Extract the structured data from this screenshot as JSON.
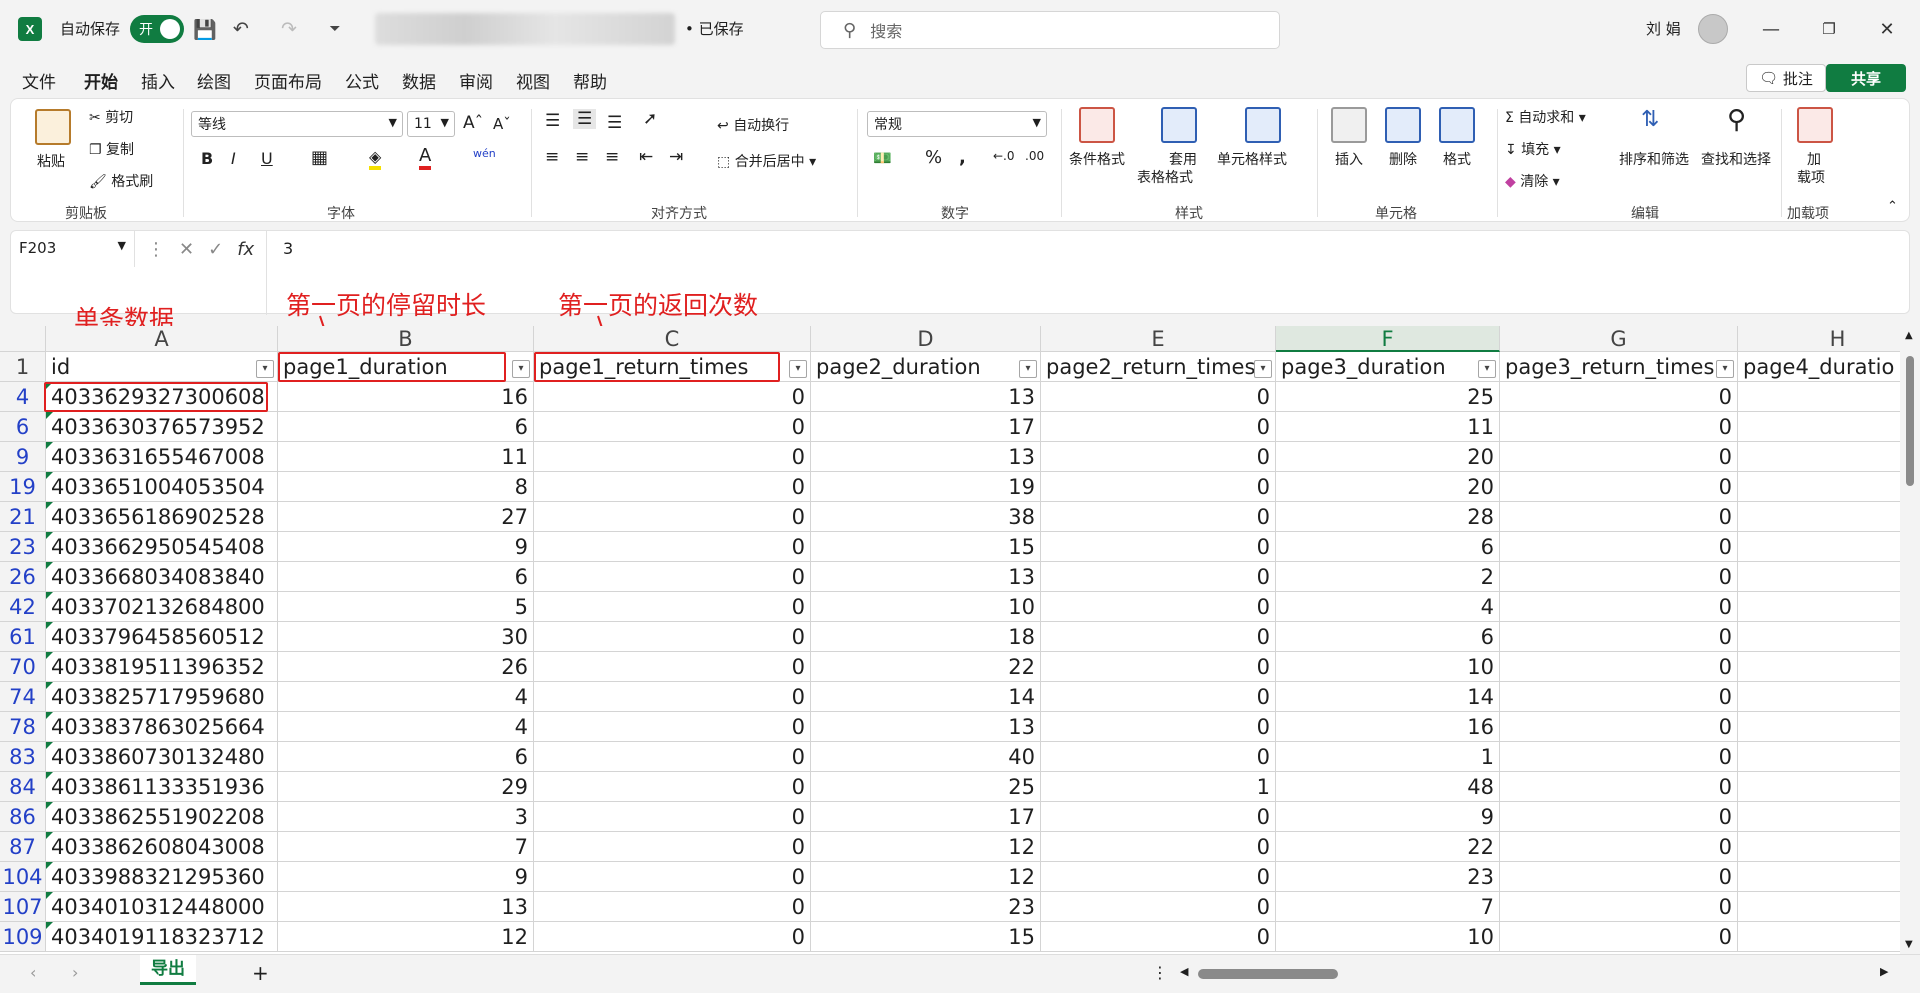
{
  "title_bar": {
    "app_logo": "X",
    "autosave_label": "自动保存",
    "autosave_state": "开",
    "saved_status": "• 已保存",
    "search_placeholder": "搜索",
    "user_name": "刘 娟"
  },
  "menu": {
    "tabs": [
      "文件",
      "开始",
      "插入",
      "绘图",
      "页面布局",
      "公式",
      "数据",
      "审阅",
      "视图",
      "帮助"
    ],
    "active_tab": "开始",
    "comments_label": "批注",
    "share_label": "共享"
  },
  "ribbon": {
    "clipboard": {
      "paste": "粘贴",
      "cut": "剪切",
      "copy": "复制",
      "format_painter": "格式刷",
      "group": "剪贴板"
    },
    "font": {
      "font_name": "等线",
      "font_size": "11",
      "group": "字体"
    },
    "alignment": {
      "wrap": "自动换行",
      "merge": "合并后居中",
      "group": "对齐方式"
    },
    "number": {
      "format": "常规",
      "group": "数字"
    },
    "styles": {
      "conditional": "条件格式",
      "table_line1": "套用",
      "table_line2": "表格格式",
      "cell_styles": "单元格样式",
      "group": "样式"
    },
    "cells": {
      "insert": "插入",
      "delete": "删除",
      "format": "格式",
      "group": "单元格"
    },
    "editing": {
      "autosum": "自动求和",
      "fill": "填充",
      "clear": "清除",
      "sort": "排序和筛选",
      "find": "查找和选择",
      "group": "编辑"
    },
    "addins": {
      "line1": "加",
      "line2": "载项",
      "group": "加载项"
    }
  },
  "formula_bar": {
    "name_box": "F203",
    "value": "3"
  },
  "annotations": {
    "single_record": "单条数据",
    "page1_duration": "第一页的停留时长",
    "page1_return": "第一页的返回次数"
  },
  "sheet": {
    "columns": [
      "A",
      "B",
      "C",
      "D",
      "E",
      "F",
      "G",
      "H"
    ],
    "headers": [
      "id",
      "page1_duration",
      "page1_return_times",
      "page2_duration",
      "page2_return_times",
      "page3_duration",
      "page3_return_times",
      "page4_duratio"
    ],
    "rows": [
      {
        "row": "4",
        "cells": [
          "4033629327300608",
          "16",
          "0",
          "13",
          "0",
          "25",
          "0",
          ""
        ]
      },
      {
        "row": "6",
        "cells": [
          "4033630376573952",
          "6",
          "0",
          "17",
          "0",
          "11",
          "0",
          ""
        ]
      },
      {
        "row": "9",
        "cells": [
          "4033631655467008",
          "11",
          "0",
          "13",
          "0",
          "20",
          "0",
          ""
        ]
      },
      {
        "row": "19",
        "cells": [
          "4033651004053504",
          "8",
          "0",
          "19",
          "0",
          "20",
          "0",
          ""
        ]
      },
      {
        "row": "21",
        "cells": [
          "4033656186902528",
          "27",
          "0",
          "38",
          "0",
          "28",
          "0",
          ""
        ]
      },
      {
        "row": "23",
        "cells": [
          "4033662950545408",
          "9",
          "0",
          "15",
          "0",
          "6",
          "0",
          ""
        ]
      },
      {
        "row": "26",
        "cells": [
          "4033668034083840",
          "6",
          "0",
          "13",
          "0",
          "2",
          "0",
          ""
        ]
      },
      {
        "row": "42",
        "cells": [
          "4033702132684800",
          "5",
          "0",
          "10",
          "0",
          "4",
          "0",
          ""
        ]
      },
      {
        "row": "61",
        "cells": [
          "4033796458560512",
          "30",
          "0",
          "18",
          "0",
          "6",
          "0",
          ""
        ]
      },
      {
        "row": "70",
        "cells": [
          "4033819511396352",
          "26",
          "0",
          "22",
          "0",
          "10",
          "0",
          ""
        ]
      },
      {
        "row": "74",
        "cells": [
          "4033825717959680",
          "4",
          "0",
          "14",
          "0",
          "14",
          "0",
          ""
        ]
      },
      {
        "row": "78",
        "cells": [
          "4033837863025664",
          "4",
          "0",
          "13",
          "0",
          "16",
          "0",
          ""
        ]
      },
      {
        "row": "83",
        "cells": [
          "4033860730132480",
          "6",
          "0",
          "40",
          "0",
          "1",
          "0",
          ""
        ]
      },
      {
        "row": "84",
        "cells": [
          "4033861133351936",
          "29",
          "0",
          "25",
          "1",
          "48",
          "0",
          ""
        ]
      },
      {
        "row": "86",
        "cells": [
          "4033862551902208",
          "3",
          "0",
          "17",
          "0",
          "9",
          "0",
          ""
        ]
      },
      {
        "row": "87",
        "cells": [
          "4033862608043008",
          "7",
          "0",
          "12",
          "0",
          "22",
          "0",
          ""
        ]
      },
      {
        "row": "104",
        "cells": [
          "4033988321295360",
          "9",
          "0",
          "12",
          "0",
          "23",
          "0",
          ""
        ]
      },
      {
        "row": "107",
        "cells": [
          "4034010312448000",
          "13",
          "0",
          "23",
          "0",
          "7",
          "0",
          ""
        ]
      },
      {
        "row": "109",
        "cells": [
          "4034019118323712",
          "12",
          "0",
          "15",
          "0",
          "10",
          "0",
          ""
        ]
      }
    ],
    "selected_column": "F"
  },
  "status": {
    "sheet_tab": "导出",
    "add_sheet": "+"
  },
  "colors": {
    "accent": "#107c41",
    "annotation": "#e02020",
    "row_header_text": "#2340c7"
  }
}
